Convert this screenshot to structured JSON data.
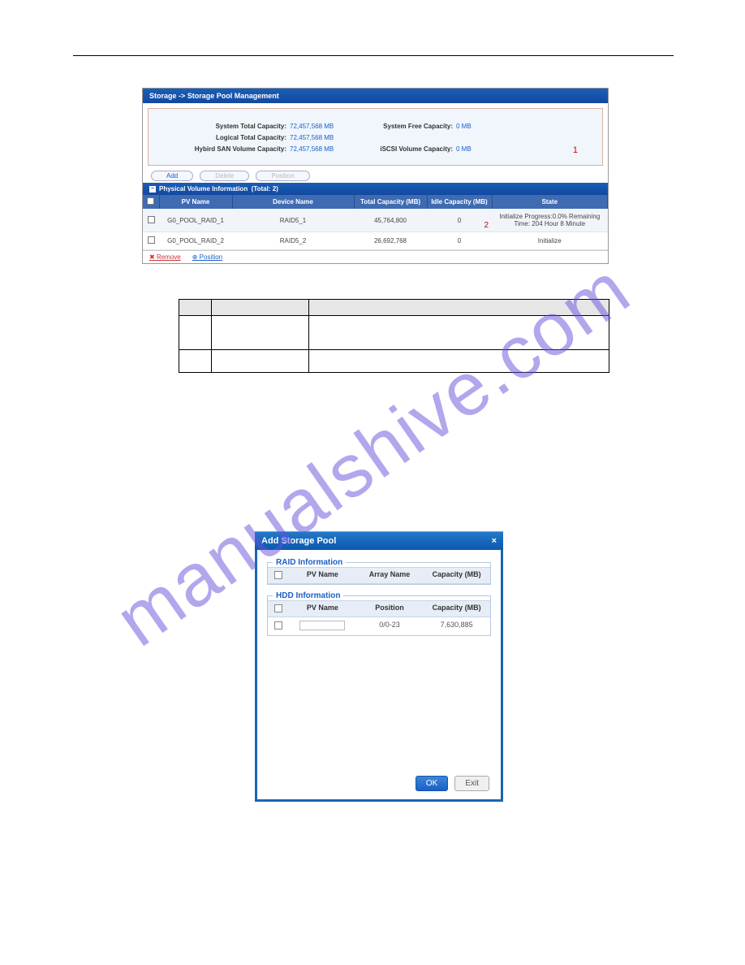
{
  "watermark": "manualshive.com",
  "shot1": {
    "title": "Storage -> Storage Pool Management",
    "caps": {
      "sys_total_label": "System Total Capacity:",
      "sys_total_val": "72,457,568 MB",
      "sys_free_label": "System Free Capacity:",
      "sys_free_val": "0 MB",
      "log_total_label": "Logical Total Capacity:",
      "log_total_val": "72,457,568 MB",
      "hyb_label": "Hybird SAN Volume Capacity:",
      "hyb_val": "72,457,568 MB",
      "iscsi_label": "iSCSI Volume Capacity:",
      "iscsi_val": "0 MB",
      "marker1": "1"
    },
    "tabs": {
      "add": "Add",
      "delete": "Delete",
      "position": "Position"
    },
    "section": {
      "label": "Physical Volume Information",
      "total": "(Total: 2)"
    },
    "columns": {
      "pv": "PV Name",
      "dev": "Device Name",
      "total": "Total Capacity (MB)",
      "idle": "Idle Capacity (MB)",
      "state": "State"
    },
    "rows": [
      {
        "pv": "G0_POOL_RAID_1",
        "dev": "RAID5_1",
        "total": "45,764,800",
        "idle": "0",
        "state": "Initialize Progress:0.0% Remaining Time: 204 Hour 8 Minute",
        "marker": "2"
      },
      {
        "pv": "G0_POOL_RAID_2",
        "dev": "RAID5_2",
        "total": "26,692,768",
        "idle": "0",
        "state": "Initialize"
      }
    ],
    "footer": {
      "remove": "Remove",
      "position": "Position"
    }
  },
  "shot2": {
    "title": "Add Storage Pool",
    "raid": {
      "legend": "RAID Information",
      "col_pv": "PV Name",
      "col_array": "Array Name",
      "col_cap": "Capacity (MB)"
    },
    "hdd": {
      "legend": "HDD Information",
      "col_pv": "PV Name",
      "col_pos": "Position",
      "col_cap": "Capacity (MB)",
      "row": {
        "position": "0/0-23",
        "capacity": "7,630,885"
      }
    },
    "buttons": {
      "ok": "OK",
      "exit": "Exit"
    }
  }
}
